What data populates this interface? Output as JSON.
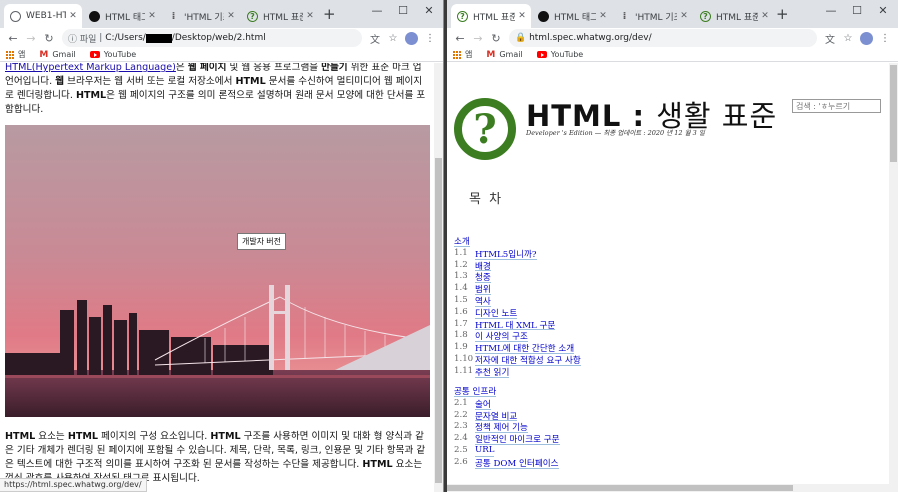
{
  "left": {
    "tabs": [
      {
        "title": "WEB1-HTML",
        "icon": "globe-icon",
        "active": true
      },
      {
        "title": "HTML 태그와",
        "icon": "circle-icon"
      },
      {
        "title": "'HTML 기초'",
        "icon": "dots-icon"
      },
      {
        "title": "HTML 표준",
        "icon": "whatwg-icon"
      }
    ],
    "omnibox": {
      "scheme": "파일",
      "path_pre": "C:/Users/",
      "path_post": "/Desktop/web/2.html"
    },
    "bookmarks": [
      "앱",
      "Gmail",
      "YouTube"
    ],
    "para1": {
      "link": "HTML(Hypertext Markup Language)",
      "a": "은 ",
      "b1": "웹 페이지",
      "c": " 및 웹 응용 프로그램을 ",
      "b2": "만들기",
      "d": " 위한 표준 마크 업 언어입니다. ",
      "b3": "웹",
      "e": " 브라우저는 웹 서버 또는 로컬 저장소에서 ",
      "b4": "HTML",
      "f": " 문서를 수신하여 멀티미디어 웹 페이지로 렌더링합니다. ",
      "b5": "HTML",
      "g": "은 웹 페이지의 구조를 의미 론적으로 설명하며 원래 문서 모양에 대한 단서를 포함합니다."
    },
    "dev_button": "개발자 버전",
    "para2": {
      "b1": "HTML",
      "a": " 요소는 ",
      "b2": "HTML",
      "b": " 페이지의 구성 요소입니다. ",
      "b3": "HTML",
      "c": " 구조를 사용하면 이미지 및 대화 형 양식과 같은 기타 개체가 렌더링 된 페이지에 포함될 수 있습니다. 제목, 단락, 목록, 링크, 인용문 및 기타 항목과 같은 텍스트에 대한 구조적 의미를 표시하여 구조화 된 문서를 작성하는 수단을 제공합니다. ",
      "b4": "HTML",
      "d": " 요소는 꺾쇠 괄호를 사용하여 작성된 태그로 표시됩니다."
    },
    "status_url": "https://html.spec.whatwg.org/dev/"
  },
  "right": {
    "tabs": [
      {
        "title": "HTML 표준",
        "icon": "whatwg-icon",
        "active": true
      },
      {
        "title": "HTML 태그와",
        "icon": "circle-icon"
      },
      {
        "title": "'HTML 기초'",
        "icon": "dots-icon"
      },
      {
        "title": "HTML 표준",
        "icon": "whatwg-icon"
      }
    ],
    "omnibox": {
      "url": "html.spec.whatwg.org/dev/"
    },
    "bookmarks": [
      "앱",
      "Gmail",
      "YouTube"
    ],
    "logo_mark": "?",
    "title_main": "HTML",
    "title_colon": " : ",
    "title_rest": "생활 표준",
    "subtitle": "Developer 's Edition — 최종 업데이트 : 2020 년 12 월 3 일",
    "search_placeholder": "검색 : 'ㅎ누르기",
    "toc_heading": "목 차",
    "toc_sections": [
      {
        "title": "소개",
        "items": [
          {
            "num": "1.1",
            "text": "HTML5입니까?"
          },
          {
            "num": "1.2",
            "text": "배경"
          },
          {
            "num": "1.3",
            "text": "청중"
          },
          {
            "num": "1.4",
            "text": "범위"
          },
          {
            "num": "1.5",
            "text": "역사"
          },
          {
            "num": "1.6",
            "text": "디자인 노트"
          },
          {
            "num": "1.7",
            "text": "HTML 대 XML 구문"
          },
          {
            "num": "1.8",
            "text": "이 사양의 구조"
          },
          {
            "num": "1.9",
            "text": "HTML에 대한 간단한 소개"
          },
          {
            "num": "1.10",
            "text": "저자에 대한 적합성 요구 사항"
          },
          {
            "num": "1.11",
            "text": "추천 읽기"
          }
        ]
      },
      {
        "title": "공통 인프라",
        "items": [
          {
            "num": "2.1",
            "text": "술어"
          },
          {
            "num": "2.2",
            "text": "문자열 비교"
          },
          {
            "num": "2.3",
            "text": "정책 제어 기능"
          },
          {
            "num": "2.4",
            "text": "일반적인 마이크로 구문"
          },
          {
            "num": "2.5",
            "text": "URL"
          },
          {
            "num": "2.6",
            "text": "공통 DOM 인터페이스"
          }
        ]
      }
    ]
  },
  "colors": {
    "whatwg_green": "#3c7d22",
    "link_blue": "#0000cc",
    "tab_strip": "#dee1e6"
  }
}
